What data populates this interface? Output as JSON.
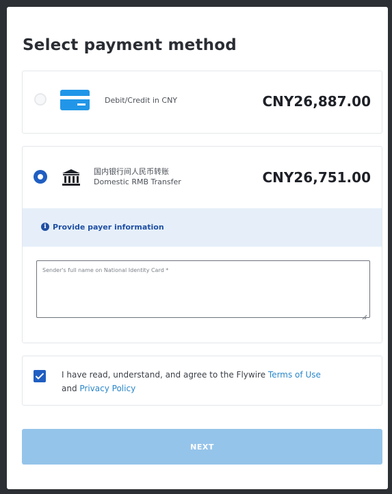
{
  "page": {
    "title": "Select payment method"
  },
  "methods": [
    {
      "label": "Debit/Credit in CNY",
      "amount": "CNY26,887.00",
      "selected": false,
      "icon": "credit-card-icon"
    },
    {
      "label_cn": "国内银行间人民币转账",
      "label": "Domestic RMB Transfer",
      "amount": "CNY26,751.00",
      "selected": true,
      "icon": "bank-icon"
    }
  ],
  "payer_info": {
    "heading": "Provide payer information",
    "icon": "info-icon",
    "name_field": {
      "placeholder": "Sender's full name on National Identity Card *",
      "value": ""
    }
  },
  "agreement": {
    "checked": true,
    "text_prefix": "I have read, understand, and agree to the Flywire ",
    "terms_link": "Terms of Use",
    "text_middle": " and ",
    "privacy_link": "Privacy Policy"
  },
  "actions": {
    "next_label": "NEXT"
  },
  "colors": {
    "accent": "#1f5ec2",
    "link": "#2a86c9",
    "card_blue": "#2196e8",
    "info_bg": "#e6eff9",
    "next_disabled": "#95c4ea"
  }
}
